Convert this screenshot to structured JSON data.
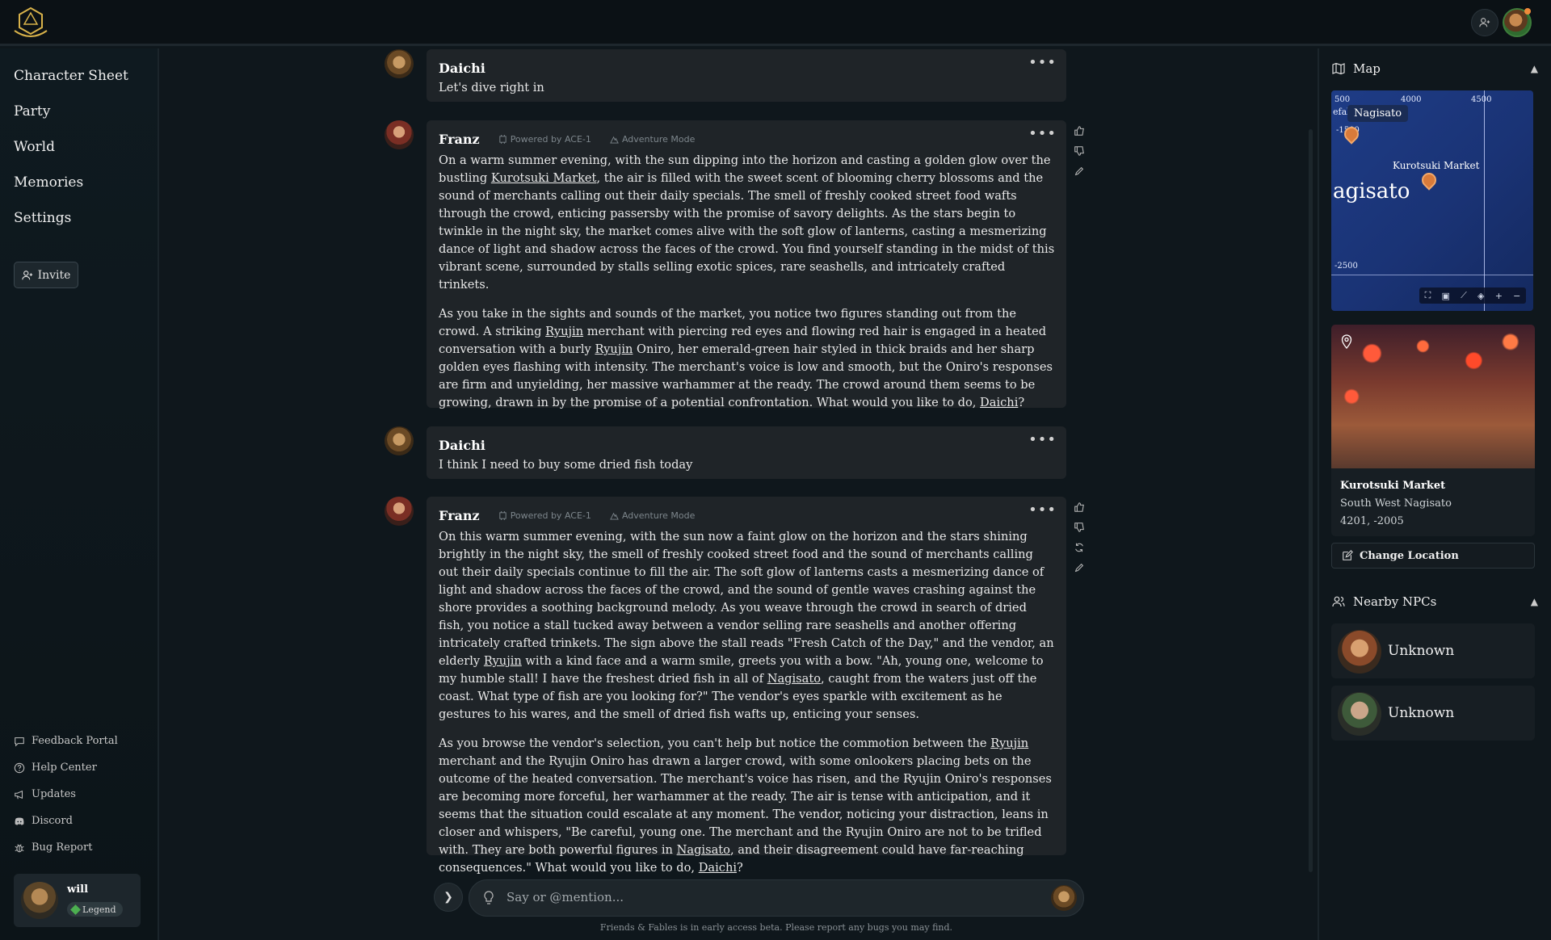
{
  "sidebar": {
    "nav": [
      "Character Sheet",
      "Party",
      "World",
      "Memories",
      "Settings"
    ],
    "invite_label": "Invite",
    "footer": [
      {
        "label": "Feedback Portal",
        "icon": "chat-bubble-icon"
      },
      {
        "label": "Help Center",
        "icon": "help-circle-icon"
      },
      {
        "label": "Updates",
        "icon": "megaphone-icon"
      },
      {
        "label": "Discord",
        "icon": "discord-icon"
      },
      {
        "label": "Bug Report",
        "icon": "bug-icon"
      }
    ],
    "user": {
      "name": "will",
      "badge": "Legend"
    }
  },
  "messages": [
    {
      "name": "Daichi",
      "text": "Let's dive right in"
    },
    {
      "name": "Franz",
      "meta1": "Powered by ACE-1",
      "meta2": "Adventure Mode"
    },
    {
      "name": "Daichi",
      "text": "I think I need to buy some dried fish today"
    },
    {
      "name": "Franz",
      "meta1": "Powered by ACE-1",
      "meta2": "Adventure Mode"
    }
  ],
  "franz1": {
    "p1": [
      "On a warm summer evening, with the sun dipping into the horizon and casting a golden glow over the bustling ",
      "Kurotsuki Market",
      ", the air is filled with the sweet scent of blooming cherry blossoms and the sound of merchants calling out their daily specials. The smell of freshly cooked street food wafts through the crowd, enticing passersby with the promise of savory delights. As the stars begin to twinkle in the night sky, the market comes alive with the soft glow of lanterns, casting a mesmerizing dance of light and shadow across the faces of the crowd. You find yourself standing in the midst of this vibrant scene, surrounded by stalls selling exotic spices, rare seashells, and intricately crafted trinkets."
    ],
    "p2": [
      "As you take in the sights and sounds of the market, you notice two figures standing out from the crowd. A striking ",
      "Ryujin",
      " merchant with piercing red eyes and flowing red hair is engaged in a heated conversation with a burly ",
      "Ryujin",
      " Oniro, her emerald-green hair styled in thick braids and her sharp golden eyes flashing with intensity. The merchant's voice is low and smooth, but the Oniro's responses are firm and unyielding, her massive warhammer at the ready. The crowd around them seems to be growing, drawn in by the promise of a potential confrontation. What would you like to do, ",
      "Daichi",
      "?"
    ]
  },
  "franz2": {
    "p1": [
      "On this warm summer evening, with the sun now a faint glow on the horizon and the stars shining brightly in the night sky, the smell of freshly cooked street food and the sound of merchants calling out their daily specials continue to fill the air. The soft glow of lanterns casts a mesmerizing dance of light and shadow across the faces of the crowd, and the sound of gentle waves crashing against the shore provides a soothing background melody. As you weave through the crowd in search of dried fish, you notice a stall tucked away between a vendor selling rare seashells and another offering intricately crafted trinkets. The sign above the stall reads \"Fresh Catch of the Day,\" and the vendor, an elderly ",
      "Ryujin",
      " with a kind face and a warm smile, greets you with a bow. \"Ah, young one, welcome to my humble stall! I have the freshest dried fish in all of ",
      "Nagisato",
      ", caught from the waters just off the coast. What type of fish are you looking for?\" The vendor's eyes sparkle with excitement as he gestures to his wares, and the smell of dried fish wafts up, enticing your senses."
    ],
    "p2": [
      "As you browse the vendor's selection, you can't help but notice the commotion between the ",
      "Ryujin",
      " merchant and the Ryujin Oniro has drawn a larger crowd, with some onlookers placing bets on the outcome of the heated conversation. The merchant's voice has risen, and the Ryujin Oniro's responses are becoming more forceful, her warhammer at the ready. The air is tense with anticipation, and it seems that the situation could escalate at any moment. The vendor, noticing your distraction, leans in closer and whispers, \"Be careful, young one. The merchant and the Ryujin Oniro are not to be trifled with. They are both powerful figures in ",
      "Nagisato",
      ", and their disagreement could have far-reaching consequences.\" What would you like to do, ",
      "Daichi",
      "?"
    ]
  },
  "composer": {
    "placeholder": "Say or @mention...",
    "note": "Friends & Fables is in early access beta. Please report any bugs you may find."
  },
  "map": {
    "title": "Map",
    "ticks": {
      "x1": "500",
      "x2": "4000",
      "x3": "4500",
      "y1": "-1500",
      "y2": "-2500"
    },
    "tag": "Nagisato",
    "edge_label": "efal",
    "place": "Kurotsuki Market",
    "big_name": "agisato"
  },
  "location": {
    "title": "Kurotsuki Market",
    "subtitle": "South West Nagisato",
    "coords": "4201, -2005",
    "change_label": "Change Location"
  },
  "npcs": {
    "title": "Nearby NPCs",
    "items": [
      "Unknown",
      "Unknown"
    ]
  }
}
